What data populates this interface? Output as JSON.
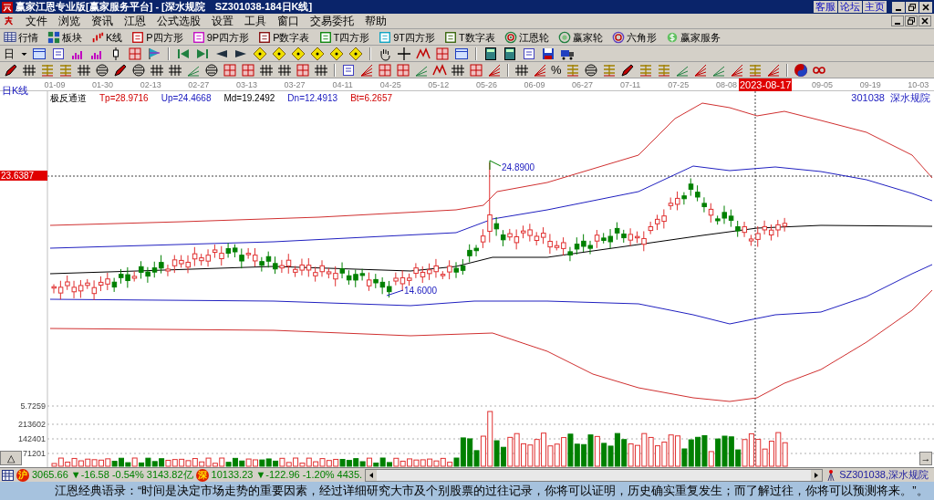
{
  "window": {
    "title": "赢家江恩专业版[赢家服务平台] - [深水规院　SZ301038-184日K线]",
    "title_buttons": [
      "客服",
      "论坛",
      "主页"
    ]
  },
  "menu": [
    "文件",
    "浏览",
    "资讯",
    "江恩",
    "公式选股",
    "设置",
    "工具",
    "窗口",
    "交易委托",
    "帮助"
  ],
  "toolbar": [
    {
      "label": "行情"
    },
    {
      "label": "板块"
    },
    {
      "label": "K线"
    },
    {
      "label": "P四方形"
    },
    {
      "label": "9P四方形"
    },
    {
      "label": "P数字表"
    },
    {
      "label": "T四方形"
    },
    {
      "label": "9T四方形"
    },
    {
      "label": "T数字表"
    },
    {
      "label": "江恩轮"
    },
    {
      "label": "赢家轮"
    },
    {
      "label": "六角形"
    },
    {
      "label": "赢家服务"
    }
  ],
  "period_button": "日",
  "percent_button": "%",
  "date_axis": {
    "dates": [
      "01-09",
      "01-30",
      "02-13",
      "02-27",
      "03-13",
      "03-27",
      "04-11",
      "04-25",
      "05-12",
      "05-26",
      "06-09",
      "06-27",
      "07-11",
      "07-25",
      "08-08",
      "09-05",
      "09-19",
      "10-03"
    ],
    "cursor_date": "2023-08-17"
  },
  "chart": {
    "period_label": "日K线",
    "indicator_name": "极反通道",
    "indicator_values": [
      {
        "text": "Tp=28.9716",
        "color": "#d00000"
      },
      {
        "text": "Up=24.4668",
        "color": "#2020c0"
      },
      {
        "text": "Md=19.2492",
        "color": "#000000"
      },
      {
        "text": "Dn=12.4913",
        "color": "#2020c0"
      },
      {
        "text": "Bt=6.2657",
        "color": "#d00000"
      }
    ],
    "stock_code": "301038",
    "stock_name": "深水规院",
    "cursor_price": "23.6387",
    "high_label": "24.8900",
    "low_label": "14.6000"
  },
  "volume": {
    "labels": [
      "5.7259",
      "213602",
      "142401",
      "71201"
    ],
    "collapse_button": "△",
    "arrow_button": "→"
  },
  "status_bar": {
    "indexes": [
      {
        "badge": "沪",
        "value": "3065.66",
        "change": "▼-16.58 -0.54%",
        "amount": "3143.82亿"
      },
      {
        "badge": "深",
        "value": "10133.23",
        "change": "▼-122.96 -1.20%",
        "amount": "4435."
      }
    ],
    "stock": "SZ301038,深水规院"
  },
  "ticker": "江恩经典语录：“时间是决定市场走势的重要因素，经过详细研究大市及个别股票的过往记录，你将可以证明，历史确实重复发生；而了解过往，你将可以预测将来。”。"
}
